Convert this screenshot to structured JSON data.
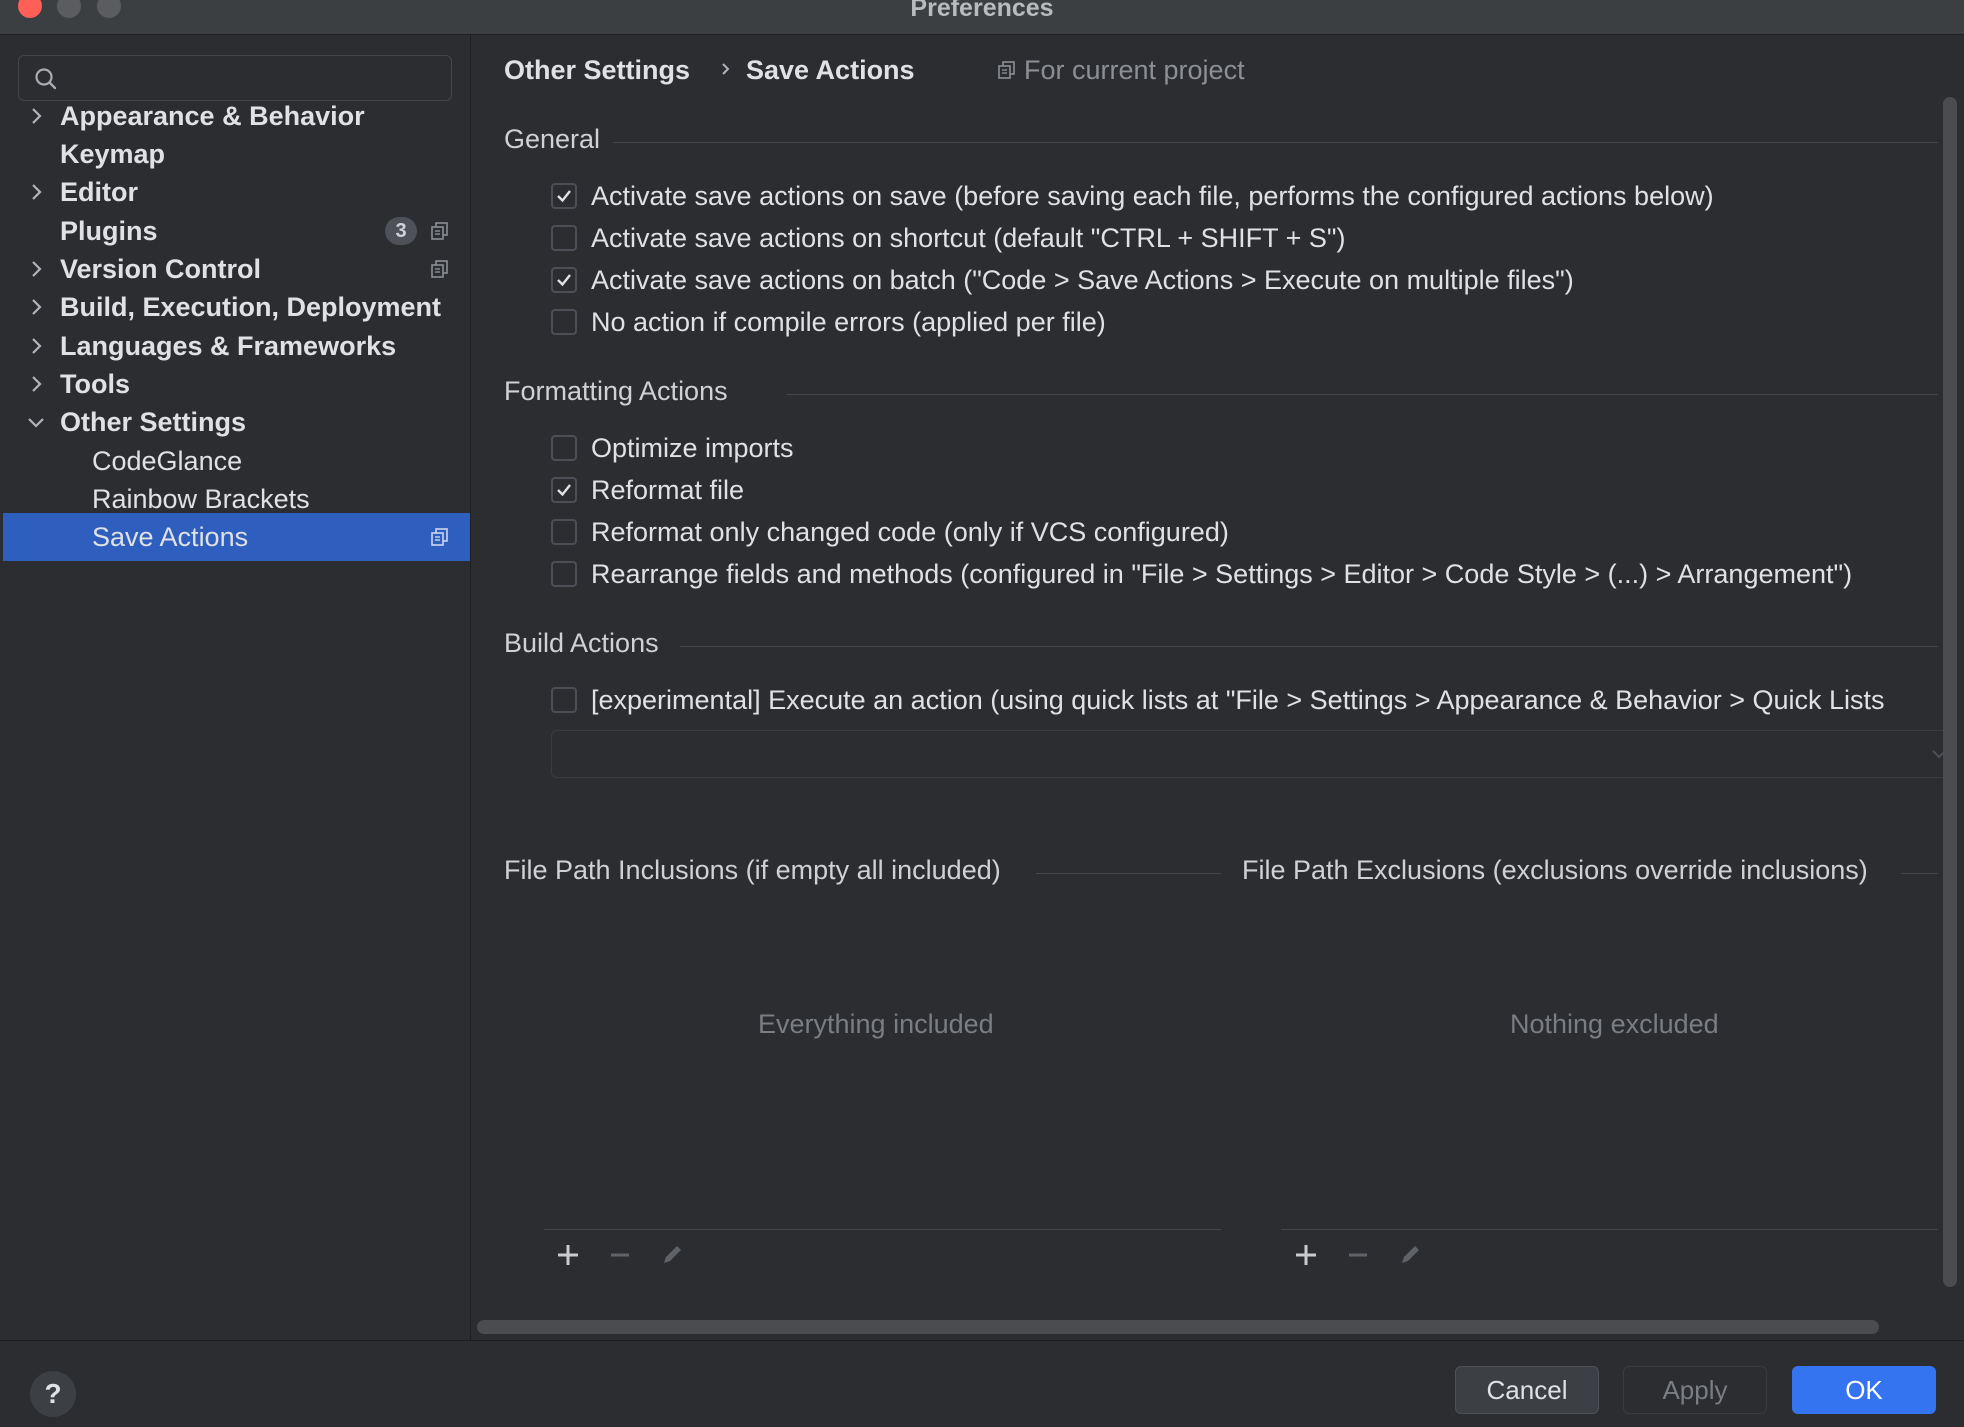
{
  "window": {
    "title": "Preferences"
  },
  "sidebar": {
    "search": {
      "placeholder": ""
    },
    "items": [
      {
        "label": "Appearance & Behavior",
        "expandable": true,
        "expanded": false
      },
      {
        "label": "Keymap",
        "expandable": false
      },
      {
        "label": "Editor",
        "expandable": true,
        "expanded": false
      },
      {
        "label": "Plugins",
        "expandable": false,
        "badge": "3",
        "project_icon": true
      },
      {
        "label": "Version Control",
        "expandable": true,
        "expanded": false,
        "project_icon": true
      },
      {
        "label": "Build, Execution, Deployment",
        "expandable": true,
        "expanded": false
      },
      {
        "label": "Languages & Frameworks",
        "expandable": true,
        "expanded": false
      },
      {
        "label": "Tools",
        "expandable": true,
        "expanded": false
      },
      {
        "label": "Other Settings",
        "expandable": true,
        "expanded": true
      },
      {
        "label": "CodeGlance",
        "child": true
      },
      {
        "label": "Rainbow Brackets",
        "child": true
      },
      {
        "label": "Save Actions",
        "child": true,
        "selected": true,
        "project_icon": true
      }
    ]
  },
  "header": {
    "breadcrumb": [
      "Other Settings",
      "Save Actions"
    ],
    "scope": "For current project"
  },
  "general": {
    "title": "General",
    "options": [
      {
        "label": "Activate save actions on save (before saving each file, performs the configured actions below)",
        "checked": true
      },
      {
        "label": "Activate save actions on shortcut (default \"CTRL + SHIFT + S\")",
        "checked": false
      },
      {
        "label": "Activate save actions on batch (\"Code > Save Actions > Execute on multiple files\")",
        "checked": true
      },
      {
        "label": "No action if compile errors (applied per file)",
        "checked": false
      }
    ]
  },
  "formatting": {
    "title": "Formatting Actions",
    "options": [
      {
        "label": "Optimize imports",
        "checked": false
      },
      {
        "label": "Reformat file",
        "checked": true
      },
      {
        "label": "Reformat only changed code (only if VCS configured)",
        "checked": false
      },
      {
        "label": "Rearrange fields and methods (configured in \"File > Settings > Editor > Code Style > (...) > Arrangement\")",
        "checked": false
      }
    ]
  },
  "build": {
    "title": "Build Actions",
    "options": [
      {
        "label": "[experimental] Execute an action (using quick lists at \"File > Settings > Appearance & Behavior > Quick Lists",
        "checked": false
      }
    ],
    "combo_value": ""
  },
  "inclusions": {
    "title": "File Path Inclusions (if empty all included)",
    "empty_text": "Everything included"
  },
  "exclusions": {
    "title": "File Path Exclusions (exclusions override inclusions)",
    "empty_text": "Nothing excluded"
  },
  "footer": {
    "help": "?",
    "cancel": "Cancel",
    "apply": "Apply",
    "ok": "OK"
  },
  "colors": {
    "accent": "#3574f0",
    "selection": "#2e5fbe",
    "background": "#2b2d30"
  }
}
